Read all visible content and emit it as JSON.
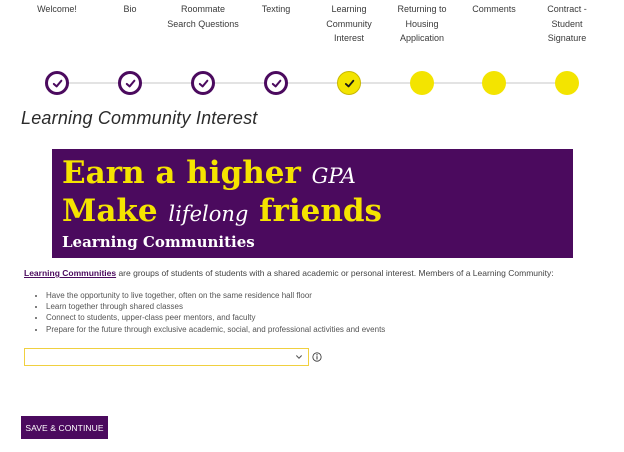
{
  "steps": [
    {
      "label": "Welcome!",
      "state": "done"
    },
    {
      "label": "Bio",
      "state": "done"
    },
    {
      "label": "Roommate Search Questions",
      "state": "done"
    },
    {
      "label": "Texting",
      "state": "done"
    },
    {
      "label": "Learning Community Interest",
      "state": "current"
    },
    {
      "label": "Returning to Housing Application",
      "state": "todo"
    },
    {
      "label": "Comments",
      "state": "todo"
    },
    {
      "label": "Contract - Student Signature",
      "state": "todo"
    }
  ],
  "page_title": "Learning Community Interest",
  "banner": {
    "line1_main": "Earn a higher",
    "line1_script": "GPA",
    "line2_main_1": "Make",
    "line2_script": "lifelong",
    "line2_main_2": "friends",
    "line3": "Learning Communities"
  },
  "intro": {
    "link_text": "Learning Communities",
    "text": " are groups of students of students with a shared academic or personal interest. Members of a Learning Community:"
  },
  "bullets": [
    "Have the opportunity to live together, often on the same residence hall floor",
    "Learn together through shared classes",
    "Connect to students, upper-class peer mentors, and faculty",
    "Prepare for the future through exclusive academic, social, and professional activities and events"
  ],
  "select": {
    "value": ""
  },
  "save_button_label": "SAVE & CONTINUE",
  "colors": {
    "purple": "#4b0a5e",
    "yellow": "#f3e400",
    "banner_yellow": "#f5e400"
  },
  "icons": {
    "done_step": "check-icon",
    "select": "chevron-down-icon",
    "info": "info-icon"
  }
}
